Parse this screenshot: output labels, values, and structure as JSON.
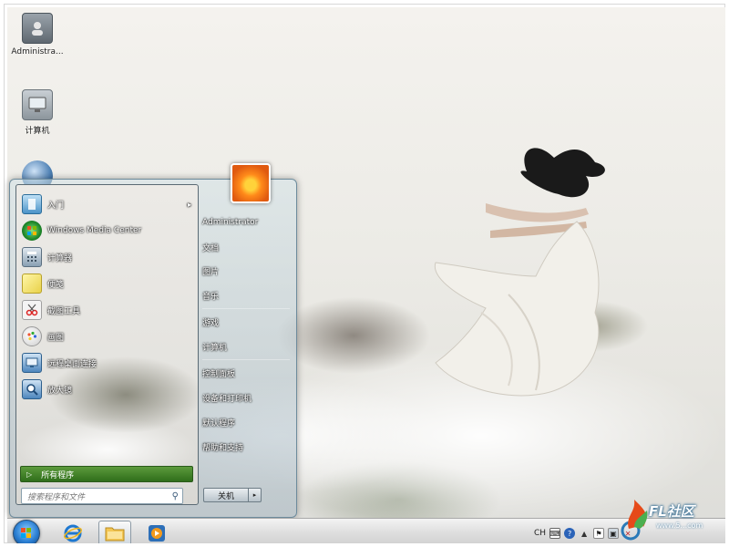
{
  "desktop": {
    "icons": [
      {
        "label": "Administra...",
        "icon": "user-folder-icon"
      },
      {
        "label": "计算机",
        "icon": "computer-icon"
      },
      {
        "label": "",
        "icon": "network-icon"
      }
    ]
  },
  "start_menu": {
    "programs": [
      {
        "label": "入门",
        "icon": "getting-started-icon",
        "has_submenu": true
      },
      {
        "label": "Windows Media Center",
        "icon": "media-center-icon",
        "has_submenu": false
      },
      {
        "label": "计算器",
        "icon": "calculator-icon",
        "has_submenu": false
      },
      {
        "label": "便笺",
        "icon": "sticky-notes-icon",
        "has_submenu": false
      },
      {
        "label": "截图工具",
        "icon": "snipping-tool-icon",
        "has_submenu": false
      },
      {
        "label": "画图",
        "icon": "paint-icon",
        "has_submenu": false
      },
      {
        "label": "远程桌面连接",
        "icon": "remote-desktop-icon",
        "has_submenu": false
      },
      {
        "label": "放大镜",
        "icon": "magnifier-icon",
        "has_submenu": false
      }
    ],
    "submenu_arrow": "▸",
    "all_programs": "所有程序",
    "search_placeholder": "搜索程序和文件",
    "right_items": [
      "Administrator",
      "文档",
      "图片",
      "音乐",
      "游戏",
      "计算机",
      "控制面板",
      "设备和打印机",
      "默认程序",
      "帮助和支持"
    ],
    "shutdown_label": "关机",
    "shutdown_arrow": "▸"
  },
  "taskbar": {
    "buttons": [
      {
        "name": "internet-explorer",
        "icon": "internet-explorer-icon",
        "active": false
      },
      {
        "name": "windows-explorer",
        "icon": "folder-icon",
        "active": true
      },
      {
        "name": "media-player",
        "icon": "media-player-icon",
        "active": false
      }
    ],
    "tray": {
      "language": "CH"
    }
  },
  "watermark": {
    "text": "FL社区",
    "sub": "www.5...com"
  },
  "colors": {
    "all_programs_green": "#3f7f27",
    "taskbar": "#dedede",
    "accent_blue": "#2b7fd3"
  }
}
